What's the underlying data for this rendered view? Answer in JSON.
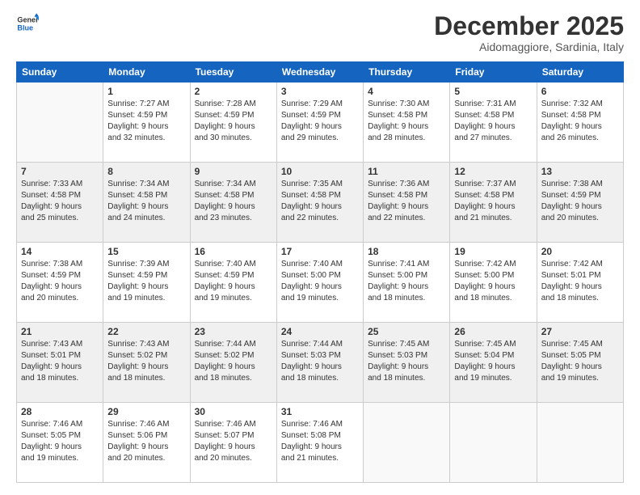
{
  "logo": {
    "line1": "General",
    "line2": "Blue"
  },
  "title": "December 2025",
  "subtitle": "Aidomaggiore, Sardinia, Italy",
  "days_of_week": [
    "Sunday",
    "Monday",
    "Tuesday",
    "Wednesday",
    "Thursday",
    "Friday",
    "Saturday"
  ],
  "weeks": [
    [
      {
        "day": "",
        "info": ""
      },
      {
        "day": "1",
        "info": "Sunrise: 7:27 AM\nSunset: 4:59 PM\nDaylight: 9 hours\nand 32 minutes."
      },
      {
        "day": "2",
        "info": "Sunrise: 7:28 AM\nSunset: 4:59 PM\nDaylight: 9 hours\nand 30 minutes."
      },
      {
        "day": "3",
        "info": "Sunrise: 7:29 AM\nSunset: 4:59 PM\nDaylight: 9 hours\nand 29 minutes."
      },
      {
        "day": "4",
        "info": "Sunrise: 7:30 AM\nSunset: 4:58 PM\nDaylight: 9 hours\nand 28 minutes."
      },
      {
        "day": "5",
        "info": "Sunrise: 7:31 AM\nSunset: 4:58 PM\nDaylight: 9 hours\nand 27 minutes."
      },
      {
        "day": "6",
        "info": "Sunrise: 7:32 AM\nSunset: 4:58 PM\nDaylight: 9 hours\nand 26 minutes."
      }
    ],
    [
      {
        "day": "7",
        "info": "Sunrise: 7:33 AM\nSunset: 4:58 PM\nDaylight: 9 hours\nand 25 minutes."
      },
      {
        "day": "8",
        "info": "Sunrise: 7:34 AM\nSunset: 4:58 PM\nDaylight: 9 hours\nand 24 minutes."
      },
      {
        "day": "9",
        "info": "Sunrise: 7:34 AM\nSunset: 4:58 PM\nDaylight: 9 hours\nand 23 minutes."
      },
      {
        "day": "10",
        "info": "Sunrise: 7:35 AM\nSunset: 4:58 PM\nDaylight: 9 hours\nand 22 minutes."
      },
      {
        "day": "11",
        "info": "Sunrise: 7:36 AM\nSunset: 4:58 PM\nDaylight: 9 hours\nand 22 minutes."
      },
      {
        "day": "12",
        "info": "Sunrise: 7:37 AM\nSunset: 4:58 PM\nDaylight: 9 hours\nand 21 minutes."
      },
      {
        "day": "13",
        "info": "Sunrise: 7:38 AM\nSunset: 4:59 PM\nDaylight: 9 hours\nand 20 minutes."
      }
    ],
    [
      {
        "day": "14",
        "info": "Sunrise: 7:38 AM\nSunset: 4:59 PM\nDaylight: 9 hours\nand 20 minutes."
      },
      {
        "day": "15",
        "info": "Sunrise: 7:39 AM\nSunset: 4:59 PM\nDaylight: 9 hours\nand 19 minutes."
      },
      {
        "day": "16",
        "info": "Sunrise: 7:40 AM\nSunset: 4:59 PM\nDaylight: 9 hours\nand 19 minutes."
      },
      {
        "day": "17",
        "info": "Sunrise: 7:40 AM\nSunset: 5:00 PM\nDaylight: 9 hours\nand 19 minutes."
      },
      {
        "day": "18",
        "info": "Sunrise: 7:41 AM\nSunset: 5:00 PM\nDaylight: 9 hours\nand 18 minutes."
      },
      {
        "day": "19",
        "info": "Sunrise: 7:42 AM\nSunset: 5:00 PM\nDaylight: 9 hours\nand 18 minutes."
      },
      {
        "day": "20",
        "info": "Sunrise: 7:42 AM\nSunset: 5:01 PM\nDaylight: 9 hours\nand 18 minutes."
      }
    ],
    [
      {
        "day": "21",
        "info": "Sunrise: 7:43 AM\nSunset: 5:01 PM\nDaylight: 9 hours\nand 18 minutes."
      },
      {
        "day": "22",
        "info": "Sunrise: 7:43 AM\nSunset: 5:02 PM\nDaylight: 9 hours\nand 18 minutes."
      },
      {
        "day": "23",
        "info": "Sunrise: 7:44 AM\nSunset: 5:02 PM\nDaylight: 9 hours\nand 18 minutes."
      },
      {
        "day": "24",
        "info": "Sunrise: 7:44 AM\nSunset: 5:03 PM\nDaylight: 9 hours\nand 18 minutes."
      },
      {
        "day": "25",
        "info": "Sunrise: 7:45 AM\nSunset: 5:03 PM\nDaylight: 9 hours\nand 18 minutes."
      },
      {
        "day": "26",
        "info": "Sunrise: 7:45 AM\nSunset: 5:04 PM\nDaylight: 9 hours\nand 19 minutes."
      },
      {
        "day": "27",
        "info": "Sunrise: 7:45 AM\nSunset: 5:05 PM\nDaylight: 9 hours\nand 19 minutes."
      }
    ],
    [
      {
        "day": "28",
        "info": "Sunrise: 7:46 AM\nSunset: 5:05 PM\nDaylight: 9 hours\nand 19 minutes."
      },
      {
        "day": "29",
        "info": "Sunrise: 7:46 AM\nSunset: 5:06 PM\nDaylight: 9 hours\nand 20 minutes."
      },
      {
        "day": "30",
        "info": "Sunrise: 7:46 AM\nSunset: 5:07 PM\nDaylight: 9 hours\nand 20 minutes."
      },
      {
        "day": "31",
        "info": "Sunrise: 7:46 AM\nSunset: 5:08 PM\nDaylight: 9 hours\nand 21 minutes."
      },
      {
        "day": "",
        "info": ""
      },
      {
        "day": "",
        "info": ""
      },
      {
        "day": "",
        "info": ""
      }
    ]
  ]
}
